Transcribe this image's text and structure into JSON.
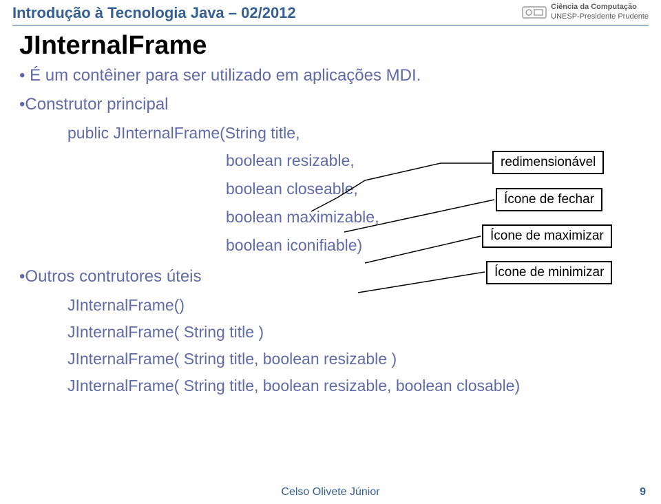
{
  "header": {
    "course_title": "Introdução à Tecnologia Java – 02/2012",
    "dept_line1": "Ciência da Computação",
    "dept_line2": "UNESP-Presidente Prudente"
  },
  "main": {
    "heading": "JInternalFrame",
    "intro": "• É um contêiner para ser utilizado em aplicações MDI.",
    "constructor_label": "•Construtor principal",
    "ctor_sig": "public JInternalFrame(String title,",
    "arg1": "boolean resizable,",
    "arg2": "boolean closeable,",
    "arg3": "boolean maximizable,",
    "arg4": "boolean iconifiable)",
    "labels": {
      "l1": "redimensionável",
      "l2": "Ícone de fechar",
      "l3": "Ícone de maximizar",
      "l4": "Ícone de minimizar"
    },
    "others_label": "•Outros contrutores úteis",
    "ctor1": "JInternalFrame()",
    "ctor2": "JInternalFrame( String title )",
    "ctor3": "JInternalFrame( String title, boolean resizable )",
    "ctor4": "JInternalFrame( String title, boolean resizable,  boolean closable)"
  },
  "footer": {
    "author": "Celso Olivete Júnior",
    "page": "9"
  }
}
